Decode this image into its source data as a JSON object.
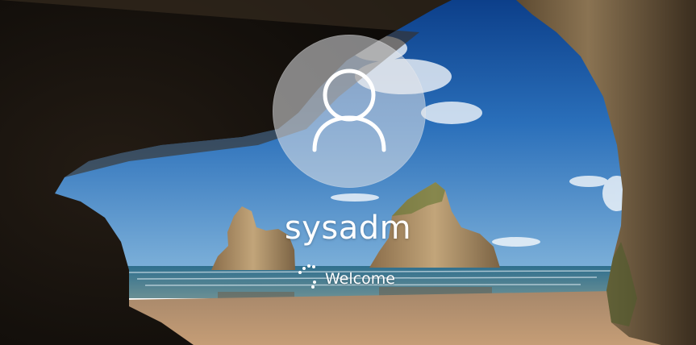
{
  "lock_screen": {
    "background": "coastal-sea-cave-wallpaper",
    "accent_color": "#ffffff"
  },
  "user": {
    "avatar_icon": "user-silhouette-icon",
    "username": "sysadm"
  },
  "status": {
    "spinner_icon": "loading-spinner-icon",
    "message": "Welcome"
  }
}
